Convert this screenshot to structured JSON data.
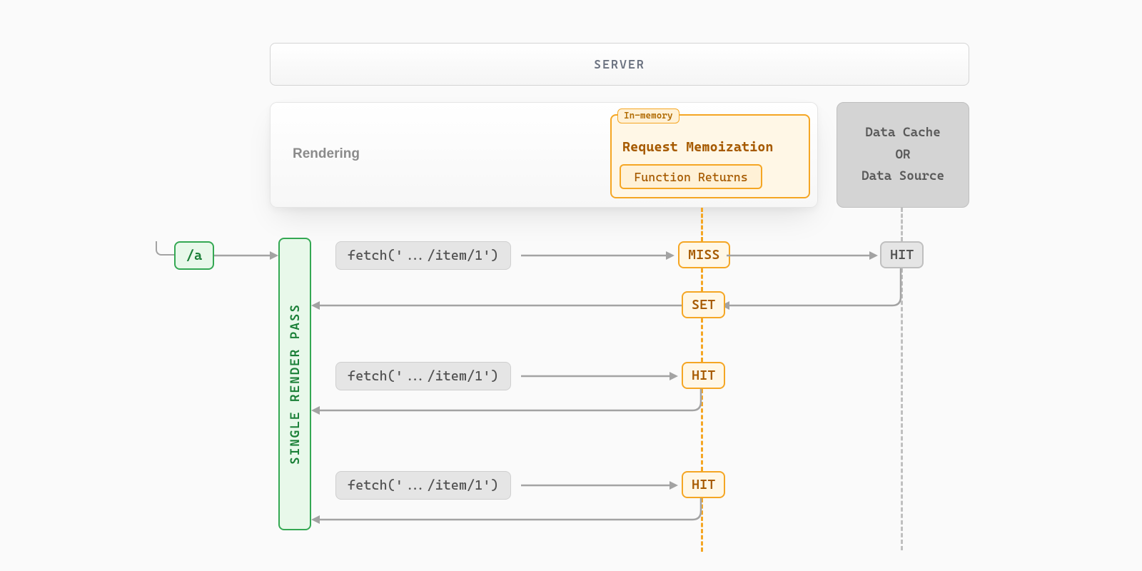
{
  "server": {
    "title": "SERVER"
  },
  "rendering": {
    "label": "Rendering",
    "memo": {
      "tag": "In-memory",
      "title": "Request Memoization",
      "func": "Function Returns"
    }
  },
  "cache": {
    "line1": "Data Cache",
    "line2": "OR",
    "line3": "Data Source"
  },
  "route": {
    "label": "/a"
  },
  "srp": {
    "label": "SINGLE RENDER PASS"
  },
  "flows": [
    {
      "fetch": "fetch('.../item/1')",
      "memoStatus": "MISS",
      "cacheStatus": "HIT",
      "set": "SET"
    },
    {
      "fetch": "fetch('.../item/1')",
      "memoStatus": "HIT"
    },
    {
      "fetch": "fetch('.../item/1')",
      "memoStatus": "HIT"
    }
  ]
}
